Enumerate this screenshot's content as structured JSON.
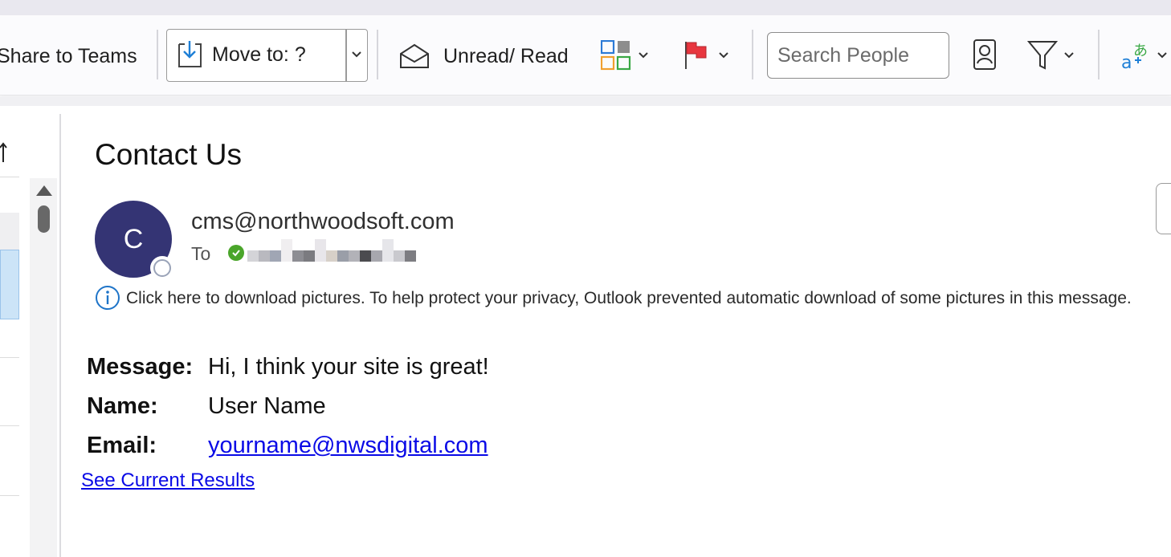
{
  "ribbon": {
    "share_label": "Share to Teams",
    "move_to_label": "Move to: ?",
    "unread_read_label": "Unread/ Read",
    "search_placeholder": "Search People"
  },
  "message": {
    "subject": "Contact Us",
    "avatar_initial": "C",
    "sender": "cms@northwoodsoft.com",
    "to_label": "To",
    "info_bar": "Click here to download pictures. To help protect your privacy, Outlook prevented automatic download of some pictures in this message."
  },
  "body": {
    "fields": [
      {
        "label": "Message:",
        "value": "Hi, I think your site is great!"
      },
      {
        "label": "Name:",
        "value": "User Name"
      },
      {
        "label": "Email:",
        "value": "yourname@nwsdigital.com"
      }
    ],
    "see_results_link": "See Current Results"
  },
  "colors": {
    "avatar": "#343474",
    "link": "#0a0ae6",
    "flag": "#e8363f",
    "presence_available": "#4aa52a"
  },
  "icons": [
    "move-to-icon",
    "envelope-open-icon",
    "categorize-icon",
    "flag-icon",
    "address-book-icon",
    "filter-icon",
    "translate-icon",
    "info-icon",
    "sort-arrow-icon"
  ]
}
